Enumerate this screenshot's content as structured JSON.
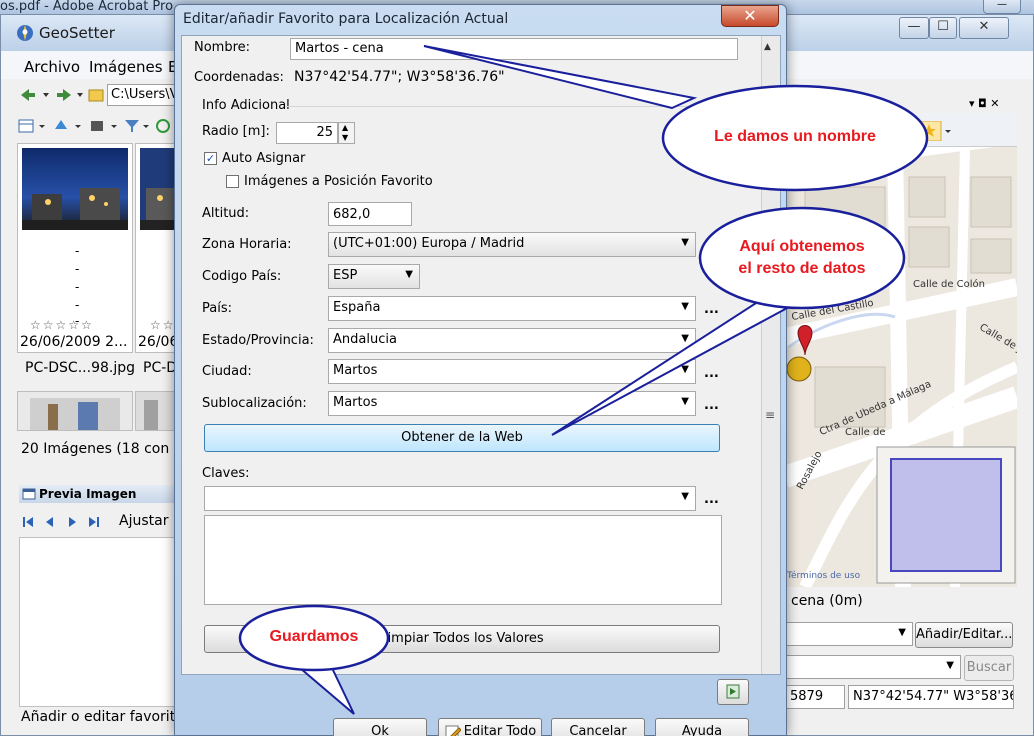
{
  "acrobat": {
    "title": "os.pdf - Adobe Acrobat Pro",
    "min_glyph": "—"
  },
  "geosetter": {
    "title": "GeoSetter",
    "window_buttons": {
      "min": "—",
      "max": "☐",
      "close": "✕"
    },
    "menu": [
      "Archivo",
      "Imágenes",
      "E"
    ],
    "address": "C:\\Users\\V",
    "thumbnails": [
      {
        "date": "26/06/2009 2...",
        "name": "PC-DSC...98.jpg",
        "stars": "☆☆☆☆☆"
      },
      {
        "date": "26/06",
        "name": "PC-D",
        "stars": "☆☆"
      }
    ],
    "dash": "-",
    "image_count": "20 Imágenes (18 con Ge",
    "preview_title": "Previa Imagen",
    "preview_adjust": "Ajustar",
    "status": "Añadir o editar favorito",
    "map": {
      "streets": [
        "Calle de Colón",
        "Calle del Castillo",
        "Calle de J",
        "Ctra de Ubeda a Málaga",
        "Calle de",
        "Rosalejo",
        "Calle de"
      ],
      "terms": "Términos de uso",
      "favorite_text": "cena (0m)",
      "edit_button": "Añadir/Editar...",
      "search_button": "Buscar",
      "coord_short": "5879",
      "coord_full": "N37°42'54.77\" W3°58'36.",
      "panel_ctrl": "▾ ◘ ✕"
    }
  },
  "dialog": {
    "title": "Editar/añadir Favorito para Localización Actual",
    "close_glyph": "✕",
    "name_label": "Nombre:",
    "name_value": "Martos - cena",
    "coords_label": "Coordenadas:",
    "coords_value": "N37°42'54.77\"; W3°58'36.76\"",
    "info_group": "Info Adicional",
    "radio_label": "Radio [m]:",
    "radio_value": "25",
    "auto_assign_label": "Auto Asignar",
    "auto_assign_checked": true,
    "images_to_fav_label": "Imágenes a Posición Favorito",
    "images_to_fav_checked": false,
    "altitude_label": "Altitud:",
    "altitude_value": "682,0",
    "timezone_label": "Zona Horaria:",
    "timezone_value": "(UTC+01:00) Europa / Madrid",
    "country_code_label": "Codigo País:",
    "country_code_value": "ESP",
    "country_label": "País:",
    "country_value": "España",
    "state_label": "Estado/Provincia:",
    "state_value": "Andalucia",
    "city_label": "Ciudad:",
    "city_value": "Martos",
    "sublocation_label": "Sublocalización:",
    "sublocation_value": "Martos",
    "get_web_button": "Obtener de la Web",
    "keywords_label": "Claves:",
    "keywords_value": "",
    "clear_button": "Limpiar Todos los Valores",
    "ok_button": "Ok",
    "edit_all_button": "Editar Todo",
    "cancel_button": "Cancelar",
    "help_button": "Ayuda",
    "ellipsis": "..."
  },
  "callouts": {
    "name": "Le damos un nombre",
    "rest_line1": "Aquí obtenemos",
    "rest_line2": "el resto de datos",
    "save": "Guardamos",
    "text_color": "#e8191f",
    "border_color": "#1a1f9c"
  }
}
